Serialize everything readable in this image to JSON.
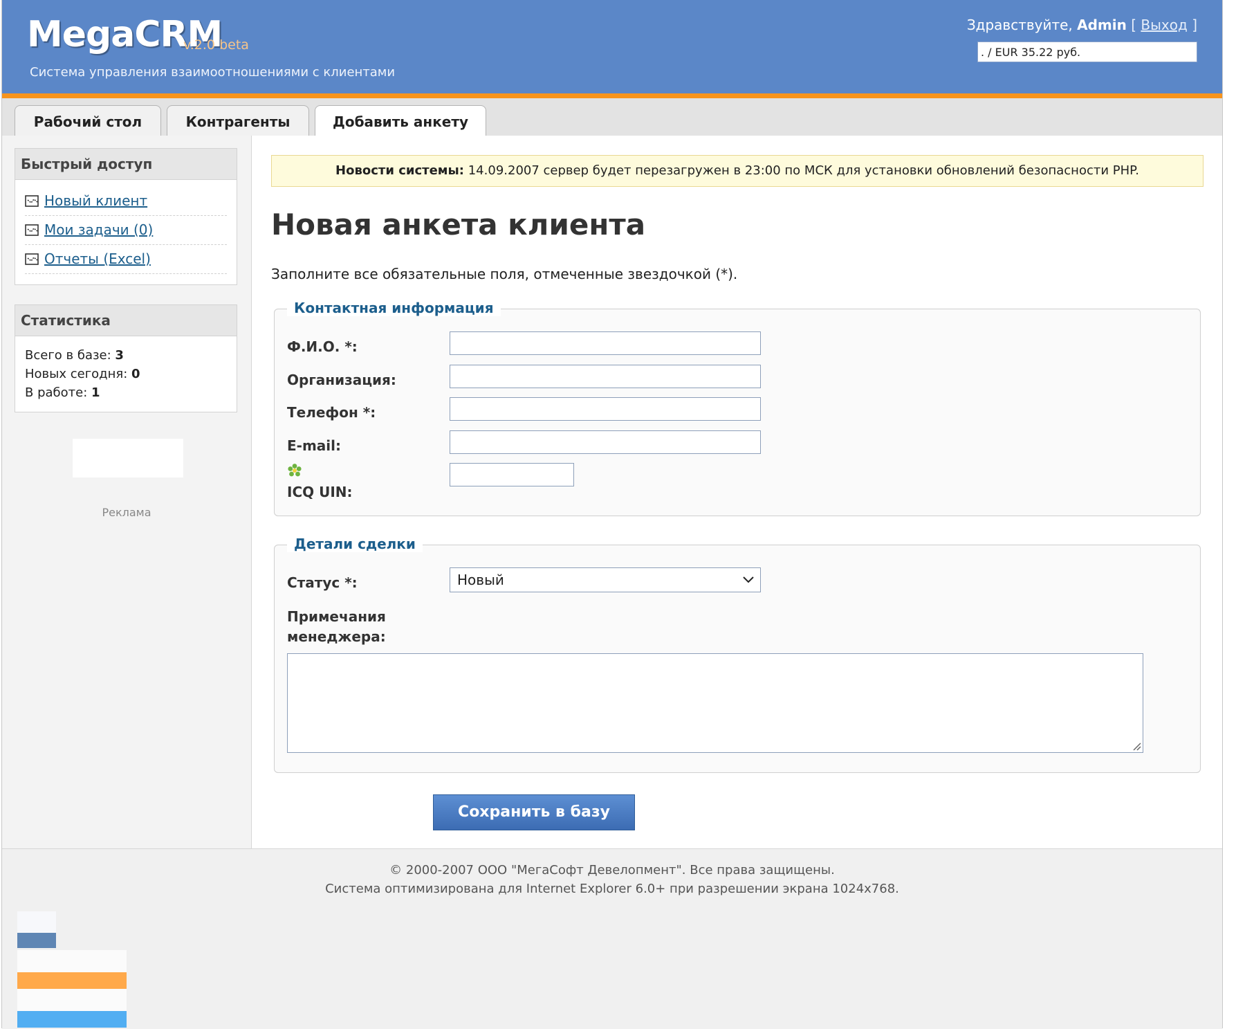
{
  "header": {
    "logo": "MegaCRM",
    "version": "v.2.0 beta",
    "tagline": "Система управления взаимоотношениями с клиентами",
    "greeting_prefix": "Здравствуйте,",
    "user": "Admin",
    "bracket_open": "[",
    "logout": "Выход",
    "bracket_close": "]",
    "currency_rate": ". / EUR 35.22 руб."
  },
  "tabs": [
    {
      "label": "Рабочий стол",
      "active": false
    },
    {
      "label": "Контрагенты",
      "active": false
    },
    {
      "label": "Добавить анкету",
      "active": true
    }
  ],
  "sidebar": {
    "quick_access": {
      "title": "Быстрый доступ",
      "items": [
        {
          "label": "Новый клиент",
          "icon": "list-icon"
        },
        {
          "label": "Мои задачи (0)",
          "icon": "list-icon"
        },
        {
          "label": "Отчеты (Excel)",
          "icon": "list-icon"
        }
      ]
    },
    "stats": {
      "title": "Статистика",
      "rows": [
        {
          "label": "Всего в базе:",
          "value": "3"
        },
        {
          "label": "Новых сегодня:",
          "value": "0"
        },
        {
          "label": "В работе:",
          "value": "1"
        }
      ]
    },
    "ad_label": "Реклама"
  },
  "main": {
    "news_label": "Новости системы:",
    "news_text": "14.09.2007 сервер будет перезагружен в 23:00 по МСК для установки обновлений безопасности PHP.",
    "title": "Новая анкета клиента",
    "intro": "Заполните все обязательные поля, отмеченные звездочкой (*).",
    "contact": {
      "legend": "Контактная информация",
      "fio": "Ф.И.О. *:",
      "org": "Организация:",
      "phone": "Телефон *:",
      "email": "E-mail:",
      "icq": "ICQ UIN:"
    },
    "deal": {
      "legend": "Детали сделки",
      "status_label": "Статус *:",
      "status_value": "Новый",
      "notes_label_1": "Примечания",
      "notes_label_2": "менеджера:"
    },
    "save_button": "Сохранить в базу"
  },
  "footer": {
    "copyright": "© 2000-2007 ООО \"МегаСофт Девелопмент\". Все права защищены.",
    "optimized": "Система оптимизирована для Internet Explorer 6.0+ при разрешении экрана 1024x768."
  },
  "colors": {
    "header_bg": "#5b87c8",
    "accent_orange": "#f7941d",
    "link_blue": "#1c5e8c",
    "news_bg": "#fefbdc"
  }
}
